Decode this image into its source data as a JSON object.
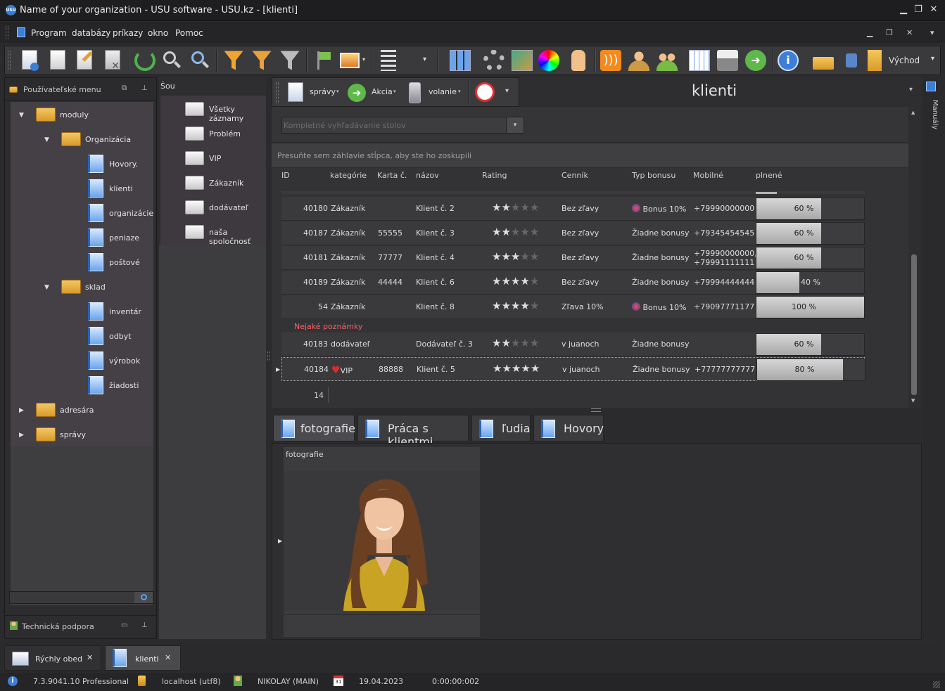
{
  "window": {
    "title": "Name of your organization - USU software - USU.kz - [klienti]",
    "logo_text": "USU"
  },
  "menubar": {
    "items": [
      "Program",
      "databázy",
      "príkazy",
      "okno",
      "Pomoc"
    ]
  },
  "toolbar": {
    "exit_label": "Východ"
  },
  "left_panel": {
    "header": "Používateľské menu",
    "tree": [
      {
        "label": "moduly"
      },
      {
        "label": "Organizácia"
      },
      {
        "label": "Hovory."
      },
      {
        "label": "klienti"
      },
      {
        "label": "organizácie"
      },
      {
        "label": "peniaze"
      },
      {
        "label": "poštové"
      },
      {
        "label": "sklad"
      },
      {
        "label": "inventár"
      },
      {
        "label": "odbyt"
      },
      {
        "label": "výrobok"
      },
      {
        "label": "žiadosti"
      },
      {
        "label": "adresára"
      },
      {
        "label": "správy"
      }
    ],
    "footer": "Technická podpora"
  },
  "show_panel": {
    "header": "Šou",
    "items": [
      "Všetky záznamy",
      "Problém",
      "VIP",
      "Zákazník",
      "dodávateľ",
      "naša spoločnosť"
    ]
  },
  "subtoolbar": {
    "spravy": "správy",
    "akcia": "Akcia",
    "volanie": "volanie"
  },
  "main": {
    "title": "klienti",
    "search_placeholder": "Kompletné vyhľadávanie stolov",
    "group_hint": "Presuňte sem záhlavie stĺpca, aby ste ho zoskupili",
    "columns": [
      "ID",
      "kategórie",
      "Karta č.",
      "názov",
      "Rating",
      "Cenník",
      "Typ bonusu",
      "Mobilné",
      "plnené"
    ],
    "rows": [
      {
        "id": "40180",
        "category": "Zákazník",
        "card": "",
        "name": "Klient č. 2",
        "rating": 2,
        "pricelist": "Bez zľavy",
        "bonus": "Bonus 10%",
        "bonus_icon": true,
        "mobile": "+79990000000",
        "mobile2": "",
        "filled": 60,
        "filled_label": "60 %"
      },
      {
        "id": "40187",
        "category": "Zákazník",
        "card": "55555",
        "name": "Klient č. 3",
        "rating": 2,
        "pricelist": "Bez zľavy",
        "bonus": "Žiadne bonusy",
        "bonus_icon": false,
        "mobile": "+79345454545",
        "mobile2": "",
        "filled": 60,
        "filled_label": "60 %"
      },
      {
        "id": "40181",
        "category": "Zákazník",
        "card": "77777",
        "name": "Klient č. 4",
        "rating": 3,
        "pricelist": "Bez zľavy",
        "bonus": "Žiadne bonusy",
        "bonus_icon": false,
        "mobile": "+79990000000,",
        "mobile2": "+79991111111",
        "filled": 60,
        "filled_label": "60 %"
      },
      {
        "id": "40189",
        "category": "Zákazník",
        "card": "44444",
        "name": "Klient č. 6",
        "rating": 4,
        "pricelist": "Bez zľavy",
        "bonus": "Žiadne bonusy",
        "bonus_icon": false,
        "mobile": "+79994444444",
        "mobile2": "",
        "filled": 40,
        "filled_label": "40 %"
      },
      {
        "id": "54",
        "category": "Zákazník",
        "card": "",
        "name": "Klient č. 8",
        "rating": 4,
        "pricelist": "Zľava 10%",
        "bonus": "Bonus 10%",
        "bonus_icon": true,
        "mobile": "+79097771177",
        "mobile2": "",
        "filled": 100,
        "filled_label": "100 %"
      }
    ],
    "note": "Nejaké poznámky",
    "rows2": [
      {
        "id": "40183",
        "category": "dodávateľ",
        "card": "",
        "name": "Dodávateľ č. 3",
        "rating": 2,
        "pricelist": "v juanoch",
        "bonus": "Žiadne bonusy",
        "bonus_icon": false,
        "mobile": "",
        "mobile2": "",
        "filled": 60,
        "filled_label": "60 %"
      },
      {
        "id": "40184",
        "category": "VIP",
        "card": "88888",
        "name": "Klient č. 5",
        "rating": 5,
        "pricelist": "v juanoch",
        "bonus": "Žiadne bonusy",
        "bonus_icon": false,
        "mobile": "+77777777777",
        "mobile2": "",
        "filled": 80,
        "filled_label": "80 %",
        "heart": true
      }
    ],
    "row_count": "14"
  },
  "tabs": [
    "fotografie",
    "Práca s klientmi",
    "ľudia",
    "Hovory"
  ],
  "photo_panel": {
    "header": "fotografie"
  },
  "right_strip": {
    "label": "Manuály"
  },
  "bottom_tabs": [
    "Rýchly obed",
    "klienti"
  ],
  "status": {
    "version": "7.3.9041.10 Professional",
    "db": "localhost (utf8)",
    "user": "NIKOLAY (MAIN)",
    "calendar_day": "31",
    "date": "19.04.2023",
    "timer": "0:00:00:002"
  }
}
